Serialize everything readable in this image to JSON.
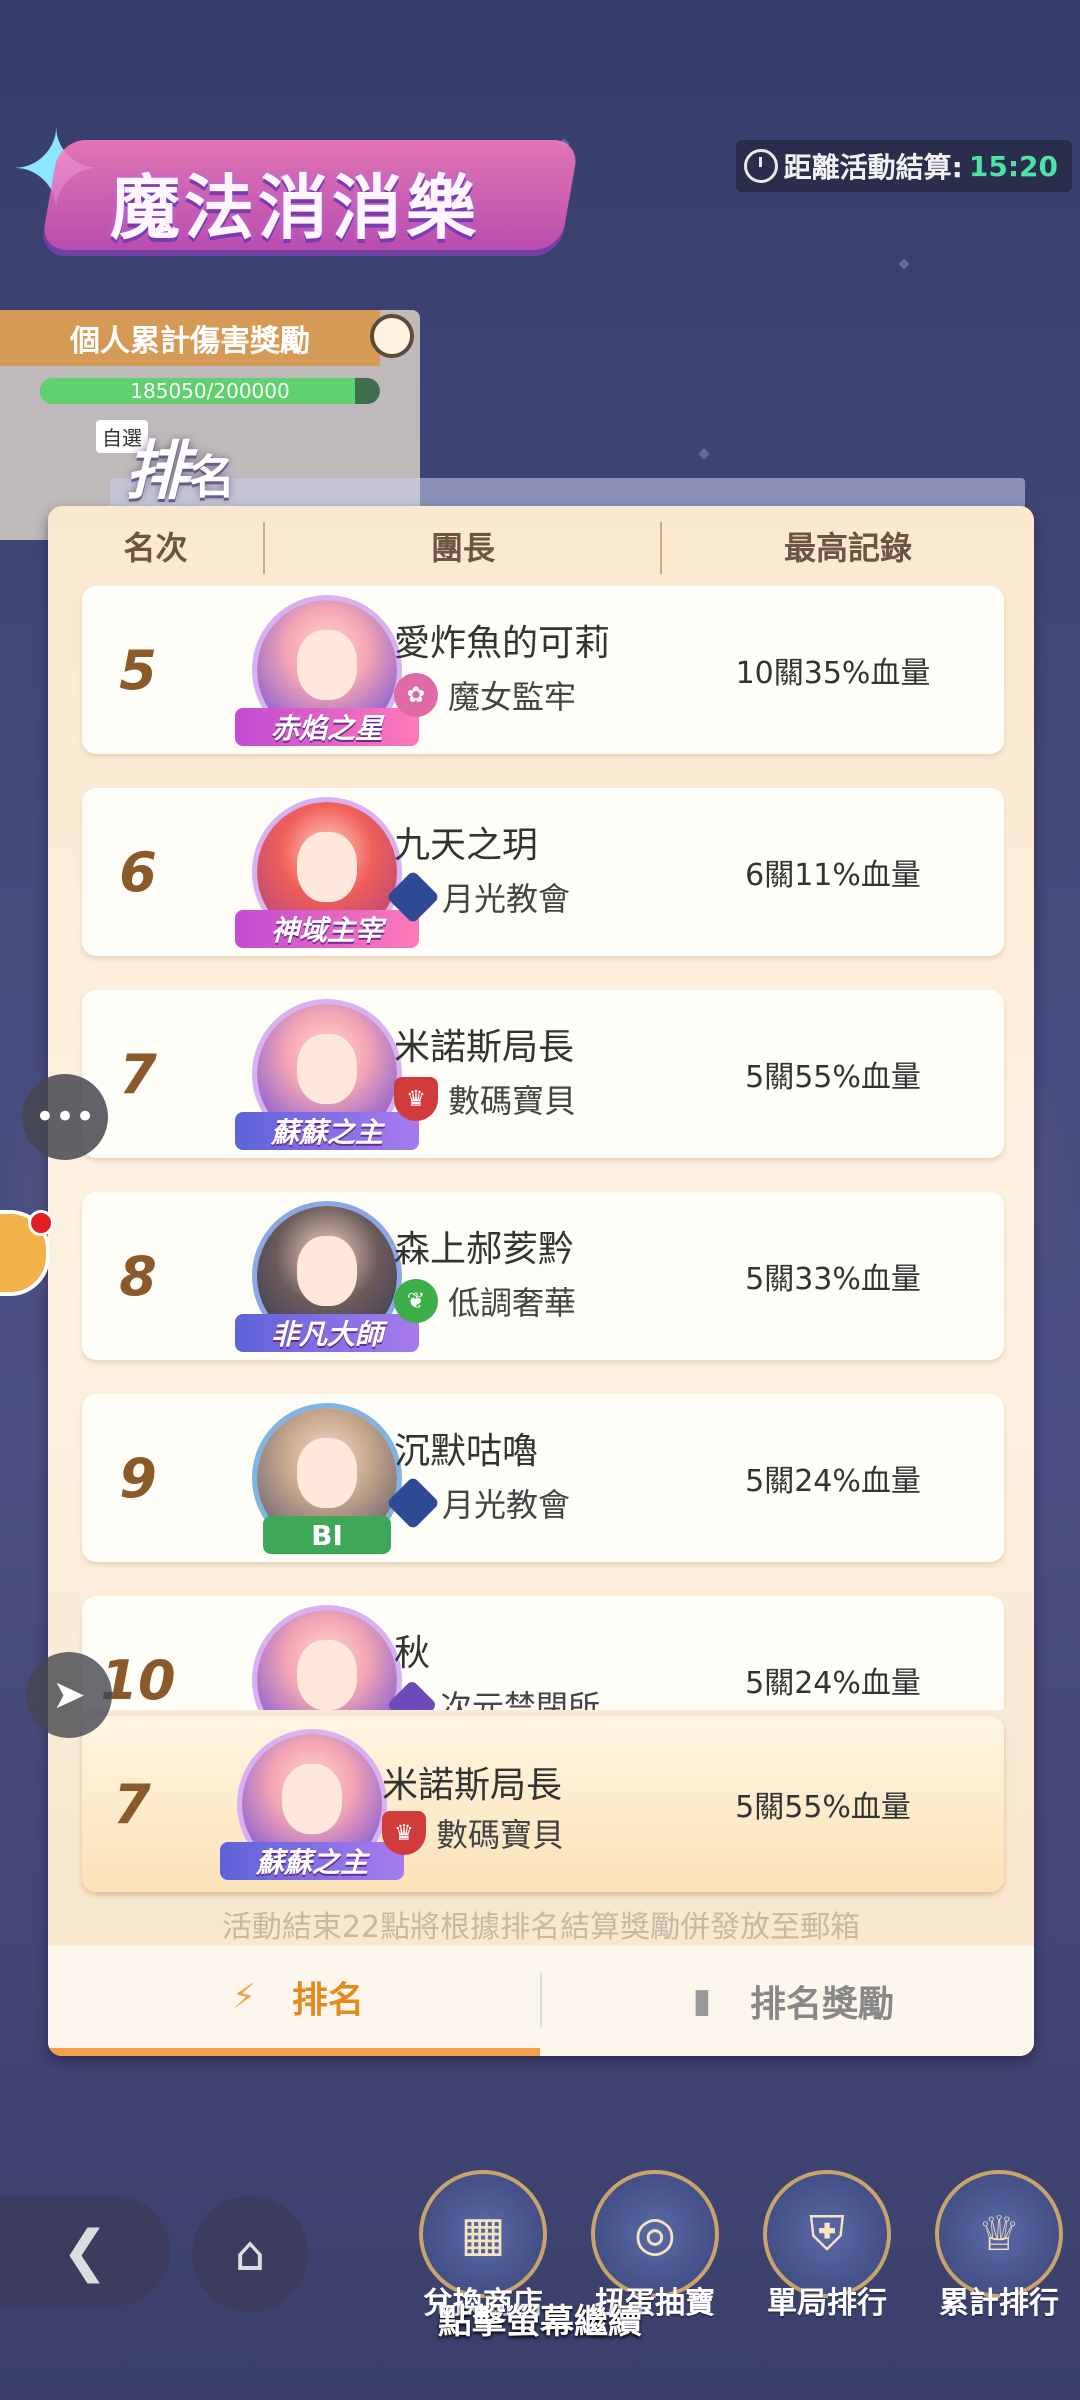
{
  "event": {
    "title": "魔法消消樂",
    "countdown_label": "距離活動結算:",
    "countdown_time": "15:20"
  },
  "damage_panel": {
    "title": "個人累計傷害獎勵",
    "progress_text": "185050/200000",
    "progress_fraction": 0.925,
    "auto_label": "自選"
  },
  "ranking": {
    "title_main": "排",
    "title_sub": "名",
    "columns": [
      "名次",
      "團長",
      "最高記錄"
    ],
    "rows": [
      {
        "rank": "5",
        "name": "愛炸魚的可莉",
        "guild": "魔女監牢",
        "record": "10關35%血量",
        "badge": "赤焰之星",
        "guild_icon": "rose-icon"
      },
      {
        "rank": "6",
        "name": "九天之玥",
        "guild": "月光教會",
        "record": "6關11%血量",
        "badge": "神域主宰",
        "guild_icon": "cat-icon"
      },
      {
        "rank": "7",
        "name": "米諾斯局長",
        "guild": "數碼寶貝",
        "record": "5關55%血量",
        "badge": "蘇蘇之主",
        "guild_icon": "crown-icon"
      },
      {
        "rank": "8",
        "name": "森上郝荄黔",
        "guild": "低調奢華",
        "record": "5關33%血量",
        "badge": "非凡大師",
        "guild_icon": "leaf-icon"
      },
      {
        "rank": "9",
        "name": "沉默咕嚕",
        "guild": "月光教會",
        "record": "5關24%血量",
        "badge": "BI",
        "guild_icon": "cat-icon"
      },
      {
        "rank": "10",
        "name": "秋",
        "guild": "次元禁閉所",
        "record": "5關24%血量",
        "badge": "",
        "guild_icon": "trident-icon"
      }
    ],
    "my_row": {
      "rank": "7",
      "name": "米諾斯局長",
      "guild": "數碼寶貝",
      "record": "5關55%血量",
      "badge": "蘇蘇之主"
    },
    "notice": "活動結束22點將根據排名結算獎勵併發放至郵箱",
    "tabs": [
      {
        "label": "排名",
        "active": true
      },
      {
        "label": "排名獎勵",
        "active": false
      }
    ]
  },
  "bottom_nav": [
    {
      "label": "兌換商店"
    },
    {
      "label": "扭蛋抽寶"
    },
    {
      "label": "單局排行"
    },
    {
      "label": "累計排行"
    }
  ],
  "continue_hint": "點擊螢幕繼續",
  "colors": {
    "accent": "#e38b1e",
    "rank_text": "#8b5a2b",
    "card_bg": "#fcf1e1",
    "countdown": "#4ce3a5"
  }
}
